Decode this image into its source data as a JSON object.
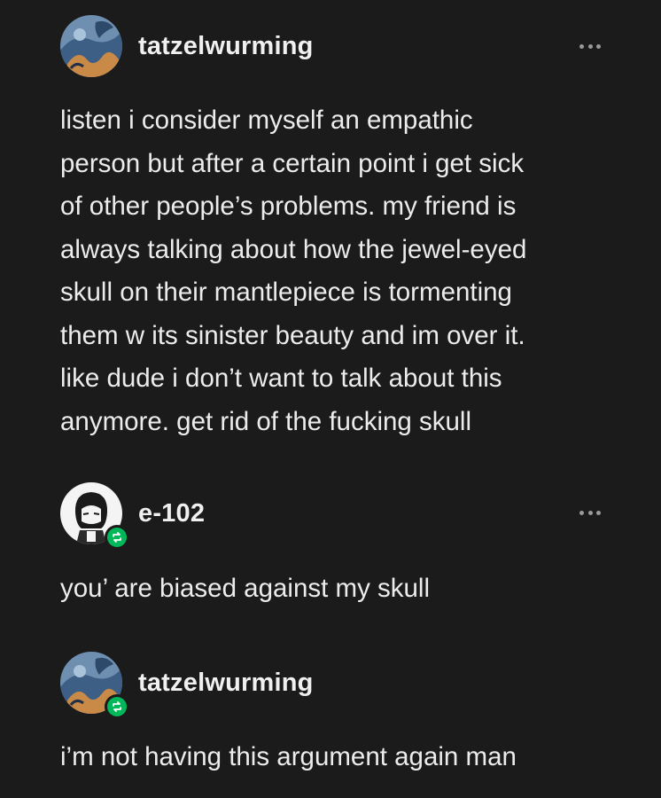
{
  "posts": [
    {
      "username": "tatzelwurming",
      "avatar": "dragon-avatar",
      "reblog": false,
      "text": "listen i consider myself an empathic\nperson but after a certain point i get sick\nof other people’s problems. my friend is\nalways talking about how the jewel-eyed\nskull on their mantlepiece is tormenting\nthem w its sinister beauty and im over it.\nlike dude i don’t want to talk about this\nanymore. get rid of the fucking skull"
    },
    {
      "username": "e-102",
      "avatar": "anime-character-avatar",
      "reblog": true,
      "text": "you’ are biased against my skull"
    },
    {
      "username": "tatzelwurming",
      "avatar": "dragon-avatar",
      "reblog": true,
      "text": "i’m not having this argument again man"
    }
  ],
  "colors": {
    "background": "#1b1b1b",
    "text": "#ececec",
    "reblog_green": "#00b85a",
    "more_dots": "#9a9a9a"
  },
  "icons": [
    "more-options-icon",
    "reblog-icon"
  ]
}
